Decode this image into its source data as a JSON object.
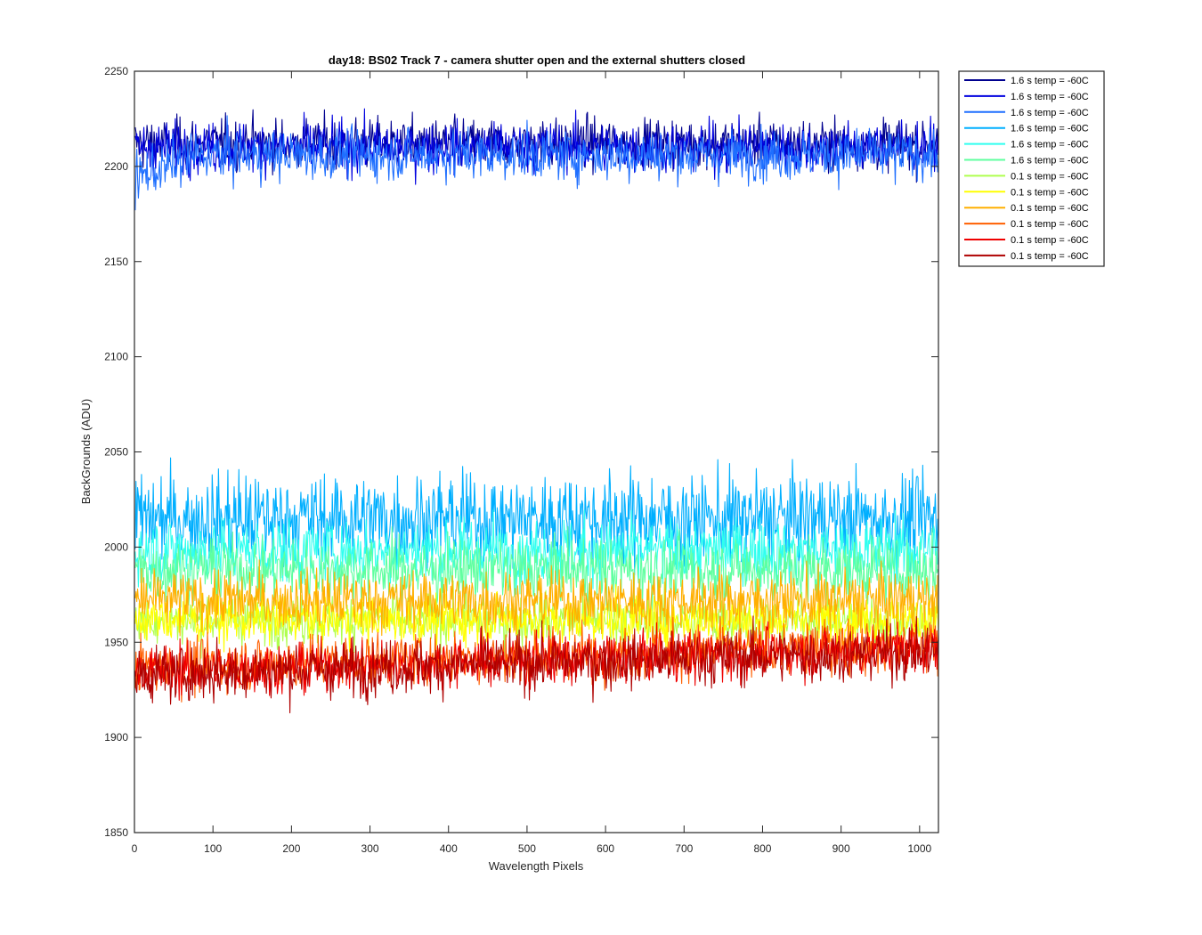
{
  "chart_data": {
    "type": "line",
    "title": "day18: BS02  Track 7 - camera shutter open and the external shutters closed",
    "xlabel": "Wavelength Pixels",
    "ylabel": "BackGrounds (ADU)",
    "xlim": [
      0,
      1024
    ],
    "ylim": [
      1850,
      2250
    ],
    "xticks": [
      0,
      100,
      200,
      300,
      400,
      500,
      600,
      700,
      800,
      900,
      1000
    ],
    "yticks": [
      1850,
      1900,
      1950,
      2000,
      2050,
      2100,
      2150,
      2200,
      2250
    ],
    "grid": false,
    "legend_position": "outside-top-right",
    "series": [
      {
        "name": "1.6 s temp = -60C",
        "color": "#00008F",
        "mean": 2212,
        "noise": 10
      },
      {
        "name": "1.6 s temp = -60C",
        "color": "#0000DF",
        "mean": 2210,
        "noise": 10
      },
      {
        "name": "1.6 s temp = -60C",
        "color": "#1F6FFF",
        "mean": 2206,
        "noise": 10
      },
      {
        "name": "1.6 s temp = -60C",
        "color": "#00AFFF",
        "mean": 2015,
        "noise": 18
      },
      {
        "name": "1.6 s temp = -60C",
        "color": "#2FFFEF",
        "mean": 1998,
        "noise": 13
      },
      {
        "name": "1.6 s temp = -60C",
        "color": "#5FFF9F",
        "mean": 1988,
        "noise": 13
      },
      {
        "name": "0.1 s temp = -60C",
        "color": "#AFFF4F",
        "mean": 1962,
        "noise": 10
      },
      {
        "name": "0.1 s temp = -60C",
        "color": "#FFFF00",
        "mean": 1962,
        "noise": 10
      },
      {
        "name": "0.1 s temp = -60C",
        "color": "#FFAF00",
        "mean": 1972,
        "noise": 12
      },
      {
        "name": "0.1 s temp = -60C",
        "color": "#FF5F00",
        "mean": 1940,
        "noise": 11
      },
      {
        "name": "0.1 s temp = -60C",
        "color": "#EF0000",
        "mean": 1938,
        "noise": 10
      },
      {
        "name": "0.1 s temp = -60C",
        "color": "#AF0000",
        "mean": 1936,
        "noise": 11
      }
    ]
  }
}
